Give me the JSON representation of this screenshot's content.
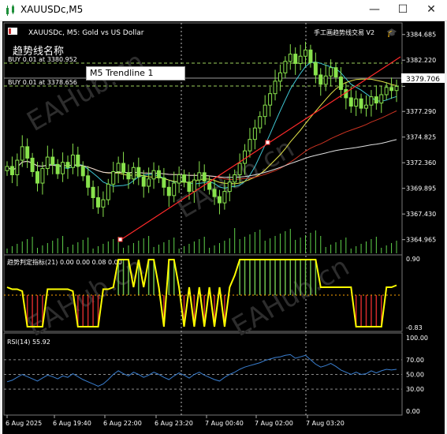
{
  "window": {
    "title": "XAUUSDc,M5",
    "minimize_glyph": "—",
    "maximize_glyph": "☐",
    "close_glyph": "✕"
  },
  "chart": {
    "header": "XAUUSDc, M5:  Gold vs US Dollar",
    "ea_name": "手工画趋势线交易 V2",
    "trendline_label": "趋势线名称",
    "trendline_input": "M5 Trendline 1",
    "buy_line_1": "BUY 0.01 at 3380.952",
    "buy_line_2": "BUY 0.01 at 3378.656",
    "current_price": "3379.706",
    "watermark": "EAHub.cn",
    "colors": {
      "background": "#000000",
      "candle_up": "#88e24c",
      "candle_down": "#88e24c",
      "grid": "#5a5a5a",
      "trendline": "#ff2a2a",
      "ma_white": "#e0e0e0",
      "ma_yellow": "#e5e54a",
      "ma_red": "#cc3322",
      "ma_cyan": "#3fc7d4"
    }
  },
  "price_axis": [
    "3384.685",
    "3382.220",
    "3379.706",
    "3377.290",
    "3374.825",
    "3372.360",
    "3369.895",
    "3367.430",
    "3364.965"
  ],
  "indicator": {
    "label": "趋势判定指标(21) 0.00 0.00 0.08 0.00",
    "axis_top": "0.90",
    "axis_bottom": "-0.83",
    "colors": {
      "line": "#ffff00",
      "bull": "#6ec24c",
      "bear": "#d22a2a"
    }
  },
  "rsi": {
    "label": "RSI(14) 55.92",
    "axis": [
      "100.00",
      "70.00",
      "50.00",
      "30.00",
      "0.00"
    ],
    "color": "#3a7fd1"
  },
  "time_axis": [
    "6 Aug 2025",
    "6 Aug 19:40",
    "6 Aug 22:00",
    "6 Aug 23:20",
    "7 Aug 00:40",
    "7 Aug 02:00",
    "7 Aug 03:20"
  ],
  "chart_data": {
    "type": "candlestick",
    "symbol": "XAUUSDc",
    "timeframe": "M5",
    "price_range": [
      3363.5,
      3385.5
    ],
    "closes": [
      3372.0,
      3371.2,
      3372.6,
      3373.9,
      3372.8,
      3371.5,
      3370.4,
      3371.8,
      3372.9,
      3372.2,
      3371.3,
      3372.4,
      3371.9,
      3373.1,
      3372.0,
      3371.1,
      3370.0,
      3369.0,
      3368.1,
      3368.8,
      3370.3,
      3371.5,
      3372.3,
      3371.4,
      3370.8,
      3371.9,
      3371.0,
      3370.1,
      3370.8,
      3371.6,
      3370.9,
      3370.0,
      3369.2,
      3370.4,
      3371.2,
      3370.5,
      3369.6,
      3370.7,
      3371.4,
      3370.6,
      3369.8,
      3369.1,
      3368.5,
      3369.6,
      3370.5,
      3371.2,
      3372.3,
      3373.5,
      3374.6,
      3375.7,
      3376.8,
      3377.9,
      3379.0,
      3380.2,
      3381.0,
      3382.1,
      3382.8,
      3381.9,
      3382.6,
      3383.2,
      3382.0,
      3380.8,
      3379.9,
      3380.7,
      3381.5,
      3380.6,
      3379.4,
      3378.6,
      3377.8,
      3378.5,
      3377.6,
      3377.9,
      3378.7,
      3378.1,
      3378.9,
      3379.6,
      3379.3,
      3379.7
    ],
    "rsi_values": [
      40,
      42,
      46,
      50,
      47,
      44,
      41,
      45,
      49,
      47,
      44,
      48,
      46,
      51,
      47,
      43,
      40,
      37,
      34,
      37,
      43,
      50,
      55,
      51,
      48,
      53,
      50,
      46,
      49,
      53,
      50,
      46,
      43,
      48,
      52,
      49,
      45,
      50,
      53,
      49,
      46,
      43,
      41,
      46,
      50,
      53,
      57,
      60,
      62,
      64,
      66,
      69,
      71,
      73,
      74,
      76,
      77,
      72,
      74,
      76,
      70,
      64,
      60,
      62,
      65,
      61,
      56,
      53,
      50,
      53,
      50,
      51,
      55,
      52,
      55,
      57,
      56,
      57
    ],
    "trend_values": [
      0.2,
      0.15,
      0.15,
      0.1,
      -0.8,
      -0.8,
      -0.8,
      -0.8,
      0.15,
      0.15,
      0.15,
      0.15,
      0.15,
      0.1,
      -0.8,
      -0.8,
      -0.8,
      -0.8,
      -0.8,
      0.15,
      0.15,
      0.2,
      0.9,
      0.9,
      0.9,
      0.2,
      0.9,
      0.2,
      0.9,
      0.9,
      0.2,
      -0.8,
      0.9,
      0.9,
      0.2,
      -0.8,
      0.2,
      -0.8,
      0.2,
      -0.8,
      0.2,
      -0.8,
      0.2,
      -0.8,
      0.2,
      0.5,
      0.9,
      0.9,
      0.9,
      0.9,
      0.9,
      0.9,
      0.9,
      0.9,
      0.9,
      0.9,
      0.9,
      0.9,
      0.9,
      0.9,
      0.9,
      0.9,
      0.2,
      0.2,
      0.2,
      0.2,
      0.2,
      0.2,
      0.2,
      -0.8,
      -0.8,
      -0.8,
      -0.8,
      -0.8,
      -0.8,
      0.2,
      0.2,
      0.25
    ]
  }
}
